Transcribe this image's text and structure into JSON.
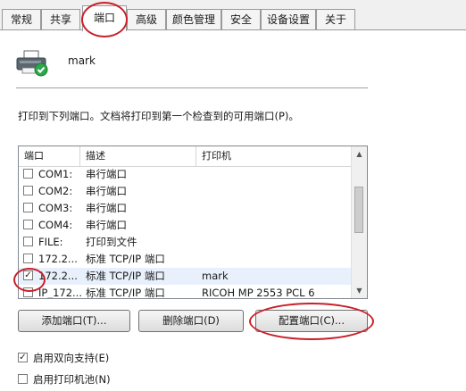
{
  "tabs": [
    {
      "label": "常规"
    },
    {
      "label": "共享"
    },
    {
      "label": "端口",
      "active": true
    },
    {
      "label": "高级"
    },
    {
      "label": "颜色管理"
    },
    {
      "label": "安全"
    },
    {
      "label": "设备设置"
    },
    {
      "label": "关于"
    }
  ],
  "printer": {
    "name": "mark",
    "icon": "printer-icon"
  },
  "description": "打印到下列端口。文档将打印到第一个检查到的可用端口(P)。",
  "ports_list": {
    "columns": [
      "端口",
      "描述",
      "打印机"
    ],
    "rows": [
      {
        "port": "COM1:",
        "desc": "串行端口",
        "printer": "",
        "checked": false
      },
      {
        "port": "COM2:",
        "desc": "串行端口",
        "printer": "",
        "checked": false
      },
      {
        "port": "COM3:",
        "desc": "串行端口",
        "printer": "",
        "checked": false
      },
      {
        "port": "COM4:",
        "desc": "串行端口",
        "printer": "",
        "checked": false
      },
      {
        "port": "FILE:",
        "desc": "打印到文件",
        "printer": "",
        "checked": false
      },
      {
        "port": "172.2...",
        "desc": "标准 TCP/IP 端口",
        "printer": "",
        "checked": false
      },
      {
        "port": "172.2...",
        "desc": "标准 TCP/IP 端口",
        "printer": "mark",
        "checked": true
      },
      {
        "port": "IP_172...",
        "desc": "标准 TCP/IP 端口",
        "printer": "RICOH MP 2553 PCL 6",
        "checked": false
      }
    ]
  },
  "buttons": {
    "add_port": "添加端口(T)...",
    "delete_port": "删除端口(D)",
    "configure_port": "配置端口(C)..."
  },
  "options": {
    "bidirectional": {
      "label": "启用双向支持(E)",
      "checked": true
    },
    "pooling": {
      "label": "启用打印机池(N)",
      "checked": false
    }
  },
  "colors": {
    "highlight_ring": "#c8202a",
    "check_green": "#2aa84a"
  }
}
